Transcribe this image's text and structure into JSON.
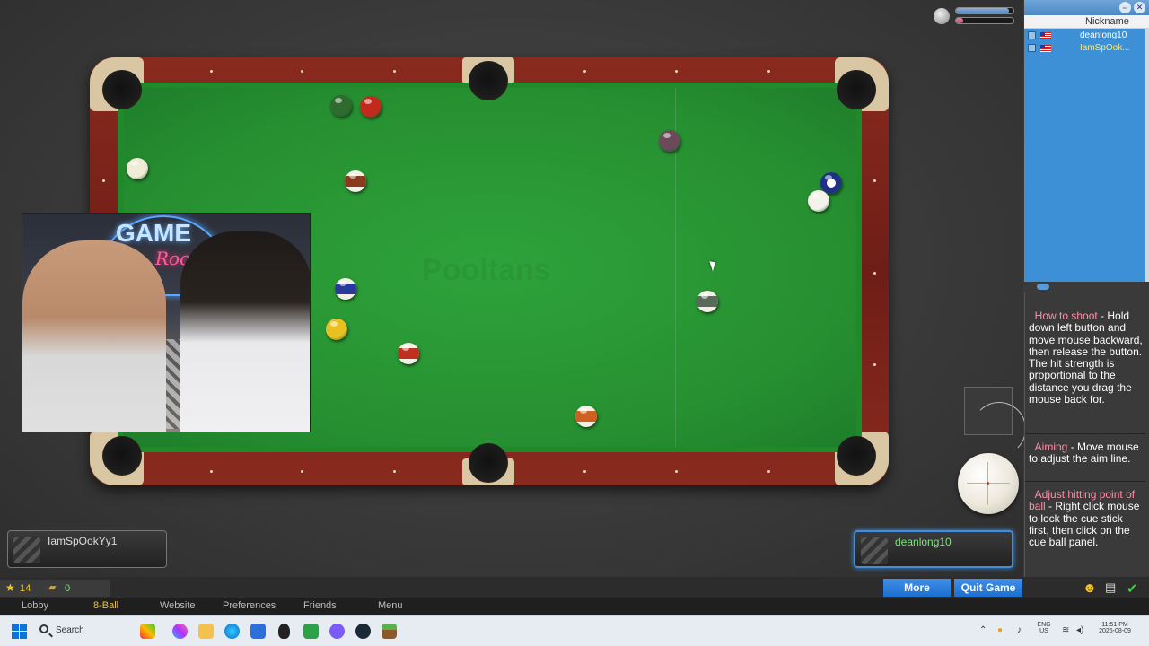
{
  "game": {
    "watermark": "Pooltans",
    "meters": {
      "power_level": 0.92,
      "opponent_level": 0.12
    },
    "balls": [
      {
        "id": "b1",
        "color": "#2f6b2f",
        "stripe": false
      },
      {
        "id": "b2",
        "color": "#c42a1c",
        "stripe": false
      },
      {
        "id": "b3",
        "color": "#6b4a5a",
        "stripe": false
      },
      {
        "id": "b4",
        "color": "#f1ecd8",
        "stripe": false
      },
      {
        "id": "b5",
        "color": "#8a3b1e",
        "stripe": true
      },
      {
        "id": "b6",
        "color": "#1f2f8a",
        "stripe": false
      },
      {
        "id": "cue",
        "color": "#f4f2ea",
        "stripe": false
      },
      {
        "id": "b7",
        "color": "#2a3a9a",
        "stripe": true
      },
      {
        "id": "b8",
        "color": "#5a6a5a",
        "stripe": true
      },
      {
        "id": "b9",
        "color": "#e8c020",
        "stripe": false
      },
      {
        "id": "b10",
        "color": "#c0301e",
        "stripe": true
      },
      {
        "id": "b11",
        "color": "#d06020",
        "stripe": true
      }
    ],
    "webcam": {
      "neon_title": "GAME",
      "neon_subtitle": "Room"
    }
  },
  "players": {
    "left": {
      "name": "IamSpOokYy1"
    },
    "right": {
      "name": "deanlong10"
    }
  },
  "sidebar": {
    "column_header": "Nickname",
    "users": [
      {
        "nick": "deanlong10",
        "highlight": false
      },
      {
        "nick": "IamSpOok...",
        "highlight": true
      }
    ],
    "help": [
      {
        "heading": "How to shoot",
        "body": " - Hold down left button and move mouse backward, then release the button. The hit strength is proportional to the distance you drag the mouse back for."
      },
      {
        "heading": "Aiming",
        "body": " - Move mouse to adjust the aim line."
      },
      {
        "heading": "Adjust hitting point of ball",
        "body": " - Right click mouse to lock the cue stick first, then click on the cue ball panel."
      }
    ]
  },
  "stats": {
    "stars": "14",
    "coins": "0"
  },
  "buttons": {
    "more": "More",
    "quit": "Quit Game"
  },
  "menu": [
    "Lobby",
    "8-Ball",
    "Website",
    "Preferences",
    "Friends",
    "Menu"
  ],
  "menu_active": "8-Ball",
  "taskbar": {
    "search_placeholder": "Search",
    "lang_top": "ENG",
    "lang_bottom": "US",
    "time": "11:51 PM",
    "date": "2025-08-09",
    "apps": [
      "pen-app-icon",
      "copilot-icon",
      "file-explorer-icon",
      "edge-icon",
      "store-icon",
      "alien-icon",
      "gamepad-icon",
      "discord-icon",
      "steam-icon",
      "minecraft-icon"
    ]
  }
}
